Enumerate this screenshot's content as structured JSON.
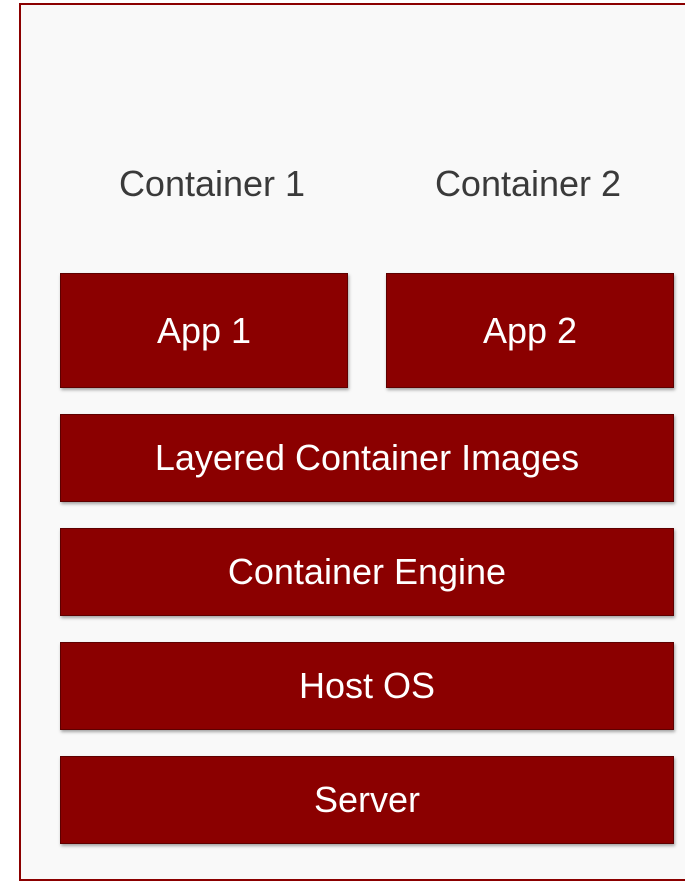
{
  "diagram": {
    "containers": [
      {
        "label": "Container 1",
        "app": "App 1"
      },
      {
        "label": "Container 2",
        "app": "App 2"
      }
    ],
    "layers": [
      "Layered Container Images",
      "Container Engine",
      "Host OS",
      "Server"
    ]
  },
  "colors": {
    "block_fill": "#8b0000",
    "frame_border": "#8b0000",
    "label_text": "#3a3a3a"
  }
}
